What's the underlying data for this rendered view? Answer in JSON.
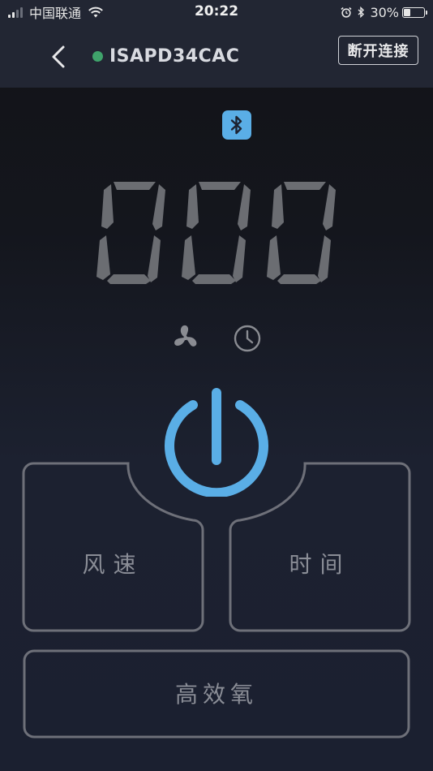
{
  "status_bar": {
    "carrier": "中国联通",
    "time": "20:22",
    "battery_percent": "30%"
  },
  "nav": {
    "device_name": "ISAPD34CAC",
    "disconnect_label": "断开连接",
    "connection_color": "#3fa36b"
  },
  "display": {
    "value": "000"
  },
  "icons": {
    "bluetooth": "bluetooth-icon",
    "fan": "fan-icon",
    "timer": "clock-icon",
    "power": "power-icon"
  },
  "controls": {
    "speed_label": "风速",
    "time_label": "时间",
    "oxygen_label": "高效氧"
  },
  "colors": {
    "accent": "#5aaee6",
    "segment": "#6b6d72",
    "outline": "#6e7079"
  }
}
